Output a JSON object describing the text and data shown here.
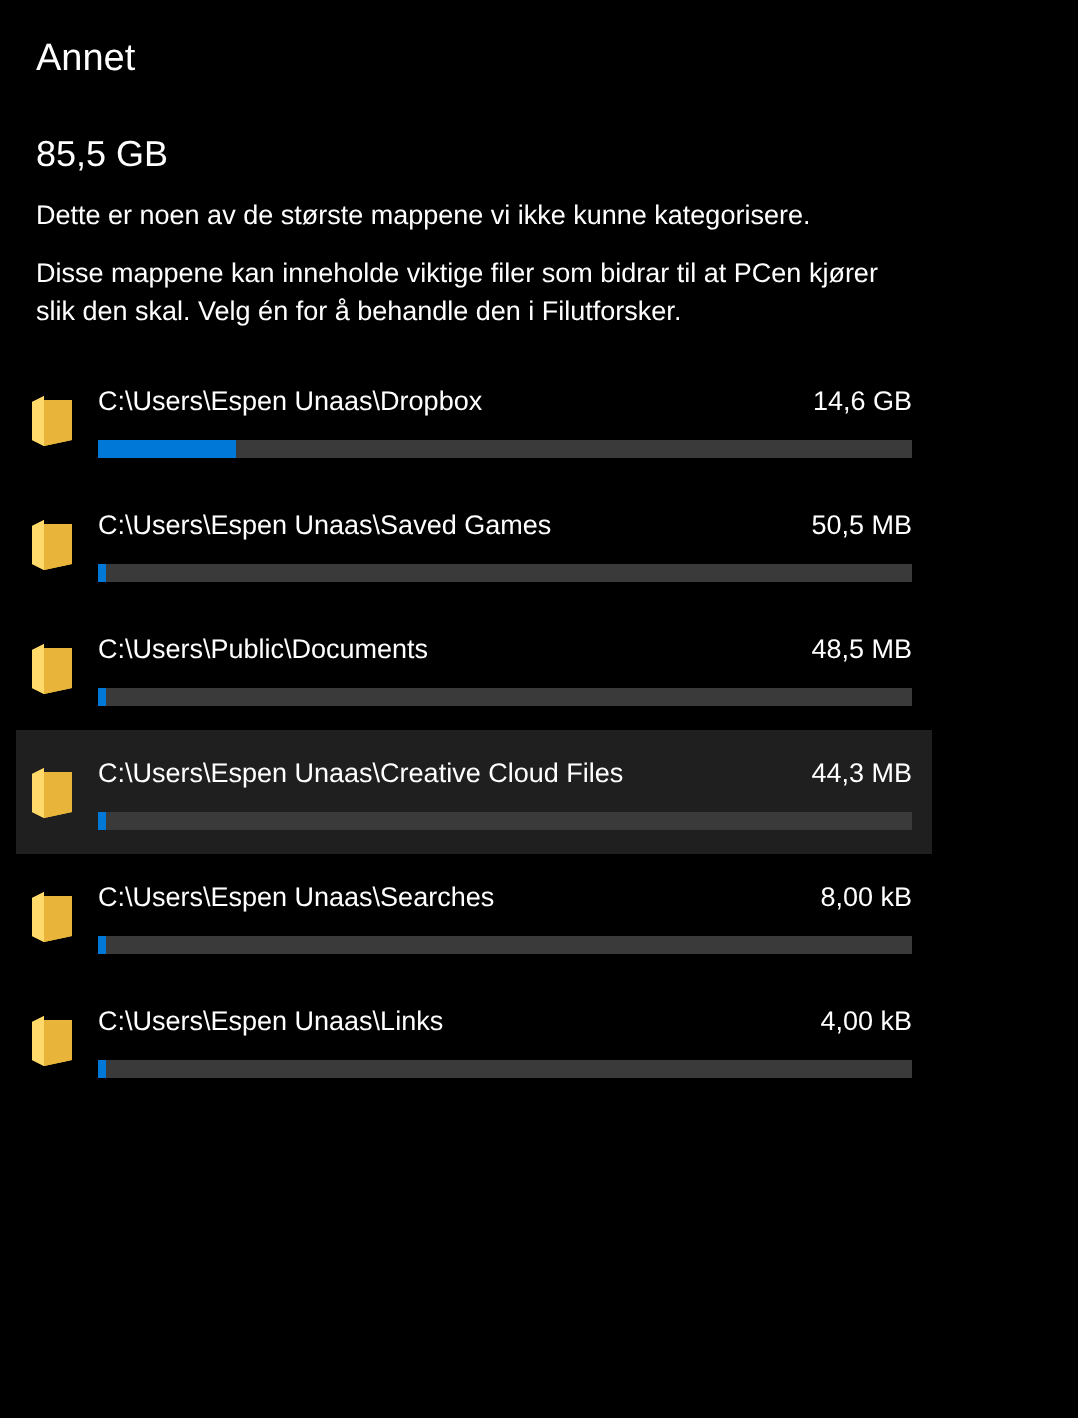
{
  "title": "Annet",
  "total": "85,5 GB",
  "description": "Dette er noen av de største mappene vi ikke kunne kategorisere.",
  "instructions": "Disse mappene kan inneholde viktige filer som bidrar til at PCen kjører slik den skal. Velg én for å behandle den i Filutforsker.",
  "folders": [
    {
      "path": "C:\\Users\\Espen Unaas\\Dropbox",
      "size": "14,6 GB",
      "level": 0.17,
      "hovered": false
    },
    {
      "path": "C:\\Users\\Espen Unaas\\Saved Games",
      "size": "50,5 MB",
      "level": 0.01,
      "hovered": false
    },
    {
      "path": "C:\\Users\\Public\\Documents",
      "size": "48,5 MB",
      "level": 0.01,
      "hovered": false
    },
    {
      "path": "C:\\Users\\Espen Unaas\\Creative Cloud Files",
      "size": "44,3 MB",
      "level": 0.01,
      "hovered": true
    },
    {
      "path": "C:\\Users\\Espen Unaas\\Searches",
      "size": "8,00 kB",
      "level": 0.01,
      "hovered": false
    },
    {
      "path": "C:\\Users\\Espen Unaas\\Links",
      "size": "4,00 kB",
      "level": 0.01,
      "hovered": false
    }
  ]
}
